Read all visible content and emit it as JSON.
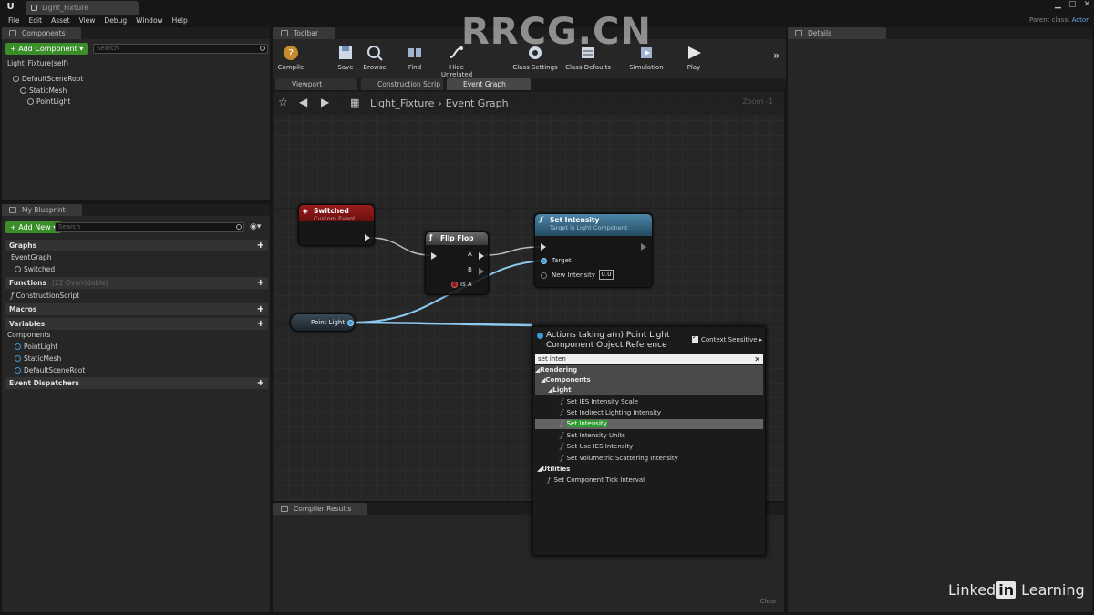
{
  "title_bar": {
    "tab": "Light_Fixture",
    "parent_class_label": "Parent class:",
    "parent_class_value": "Actor"
  },
  "menu": [
    "File",
    "Edit",
    "Asset",
    "View",
    "Debug",
    "Window",
    "Help"
  ],
  "components": {
    "tab": "Components",
    "add_button": "+ Add Component ▾",
    "search_placeholder": "Search",
    "tree": [
      "Light_Fixture(self)",
      "DefaultSceneRoot",
      "StaticMesh",
      "PointLight"
    ]
  },
  "my_blueprint": {
    "tab": "My Blueprint",
    "add_button": "+ Add New ▾",
    "search_placeholder": "Search",
    "sections": {
      "graphs": "Graphs",
      "event_graph": "EventGraph",
      "switched": "Switched",
      "functions": "Functions",
      "functions_hint": "(22 Overridable)",
      "construction_script": "ConstructionScript",
      "macros": "Macros",
      "variables": "Variables",
      "components": "Components",
      "var_pointlight": "PointLight",
      "var_staticmesh": "StaticMesh",
      "var_defaultsceneroot": "DefaultSceneRoot",
      "event_dispatchers": "Event Dispatchers"
    }
  },
  "toolbar": {
    "tab": "Toolbar",
    "buttons": [
      "Compile",
      "Save",
      "Browse",
      "Find",
      "Hide Unrelated",
      "Class Settings",
      "Class Defaults",
      "Simulation",
      "Play"
    ]
  },
  "editor_tabs": [
    "Viewport",
    "Construction Scrip",
    "Event Graph"
  ],
  "graph": {
    "breadcrumb_root": "Light_Fixture",
    "breadcrumb_current": "Event Graph",
    "zoom": "Zoom -1",
    "nodes": {
      "switched_title": "Switched",
      "switched_sub": "Custom Event",
      "flipflop_title": "Flip Flop",
      "flipflop_a": "A",
      "flipflop_b": "B",
      "flipflop_isa": "Is A",
      "setint_title": "Set Intensity",
      "setint_sub": "Target is Light Component",
      "setint_target": "Target",
      "setint_new": "New Intensity",
      "setint_value": "0.0",
      "pointlight": "Point Light"
    }
  },
  "context_menu": {
    "title": "Actions taking a(n) Point Light Component Object Reference",
    "context_sensitive": "Context Sensitive ▸",
    "search_value": "set inten",
    "cat_rendering": "◢Rendering",
    "cat_components": "◢Components",
    "cat_light": "◢Light",
    "items": [
      "Set IES Intensity Scale",
      "Set Indirect Lighting Intensity",
      "Set Intensity",
      "Set Intensity Units",
      "Set Use IES Intensity",
      "Set Volumetric Scattering Intensity"
    ],
    "cat_utilities": "◢Utilities",
    "utility_item": "Set Component Tick Interval"
  },
  "compiler": {
    "tab": "Compiler Results",
    "clear": "Clear"
  },
  "details": {
    "tab": "Details"
  },
  "watermarks": {
    "top": "RRCG.CN",
    "brand": "Linked",
    "brand_in": "in",
    "brand_end": " Learning"
  },
  "colors": {
    "event_red": "#8a1414",
    "function_blue": "#3d6e8a",
    "accent_green": "#3a8e2a",
    "wire_blue": "#8cc8f0"
  }
}
